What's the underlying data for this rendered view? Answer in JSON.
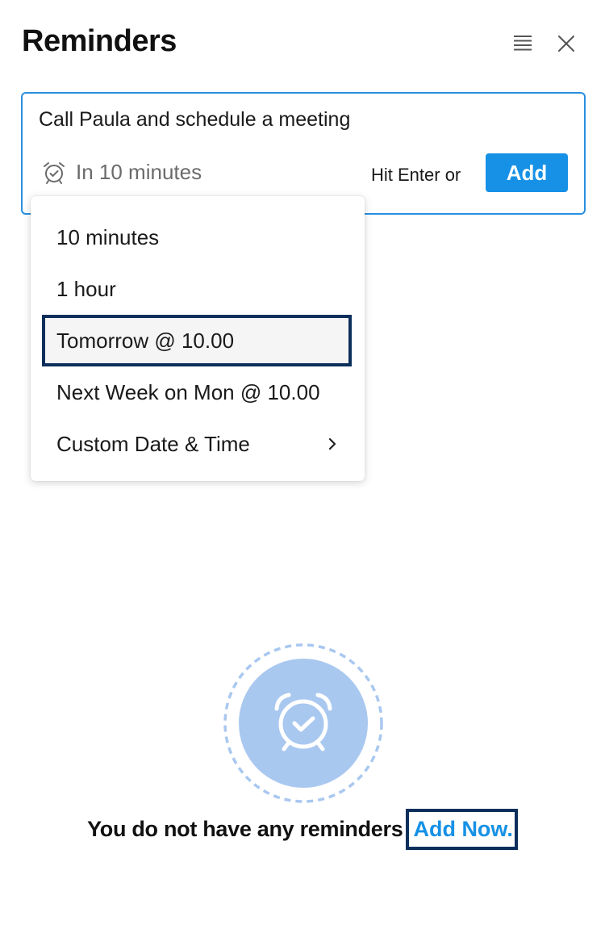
{
  "header": {
    "title": "Reminders",
    "icons": {
      "list": "list-icon",
      "close": "close-icon"
    }
  },
  "composer": {
    "text": "Call Paula and schedule a meeting",
    "time_label": "In 10 minutes",
    "time_icon": "alarm-clock-icon",
    "hint": "Hit Enter or",
    "add_label": "Add"
  },
  "time_menu": {
    "items": [
      {
        "label": "10 minutes"
      },
      {
        "label": "1 hour"
      },
      {
        "label": "Tomorrow @ 10.00",
        "highlighted": true
      },
      {
        "label": "Next Week on Mon @ 10.00"
      },
      {
        "label": "Custom Date & Time",
        "submenu": true,
        "icon": "chevron-right-icon"
      }
    ]
  },
  "empty_state": {
    "icon": "alarm-clock-icon",
    "message": "You do not have any reminders",
    "link": "Add Now."
  },
  "colors": {
    "accent": "#1691e6",
    "focus_outline": "#0c2f5c",
    "illustration": "#a9c8f0"
  }
}
